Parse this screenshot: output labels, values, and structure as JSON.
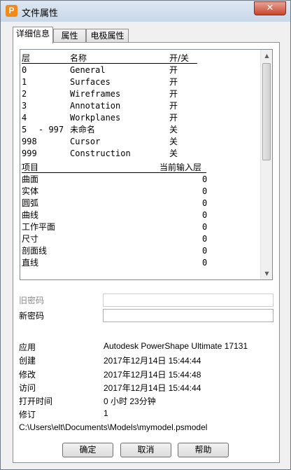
{
  "window": {
    "title": "文件属性",
    "app_icon_letter": "P",
    "close_glyph": "✕"
  },
  "tabs": [
    {
      "label": "详细信息",
      "active": true
    },
    {
      "label": "属性",
      "active": false
    },
    {
      "label": "电极属性",
      "active": false
    }
  ],
  "levels": {
    "headers": {
      "level": "层",
      "name": "名称",
      "onoff": "开/关"
    },
    "rows": [
      {
        "level": "0",
        "range_end": "",
        "name": "General",
        "state": "开"
      },
      {
        "level": "1",
        "range_end": "",
        "name": "Surfaces",
        "state": "开"
      },
      {
        "level": "2",
        "range_end": "",
        "name": "Wireframes",
        "state": "开"
      },
      {
        "level": "3",
        "range_end": "",
        "name": "Annotation",
        "state": "开"
      },
      {
        "level": "4",
        "range_end": "",
        "name": "Workplanes",
        "state": "开"
      },
      {
        "level": "5",
        "range_end": "- 997",
        "name": "未命名",
        "state": "关"
      },
      {
        "level": "998",
        "range_end": "",
        "name": "Cursor",
        "state": "关"
      },
      {
        "level": "999",
        "range_end": "",
        "name": "Construction",
        "state": "关"
      }
    ]
  },
  "input_levels": {
    "headers": {
      "item": "项目",
      "current": "当前输入层"
    },
    "rows": [
      {
        "item": "曲面",
        "value": "0"
      },
      {
        "item": "实体",
        "value": "0"
      },
      {
        "item": "圆弧",
        "value": "0"
      },
      {
        "item": "曲线",
        "value": "0"
      },
      {
        "item": "工作平面",
        "value": "0"
      },
      {
        "item": "尺寸",
        "value": "0"
      },
      {
        "item": "剖面线",
        "value": "0"
      },
      {
        "item": "直线",
        "value": "0"
      }
    ]
  },
  "scrollbar": {
    "up_glyph": "▲",
    "down_glyph": "▼"
  },
  "password": {
    "old_label": "旧密码",
    "old_value": "",
    "new_label": "新密码",
    "new_value": ""
  },
  "info": {
    "application_label": "应用",
    "application_value": "Autodesk PowerShape Ultimate 17131",
    "created_label": "创建",
    "created_value": "2017年12月14日 15:44:44",
    "modified_label": "修改",
    "modified_value": "2017年12月14日 15:44:48",
    "accessed_label": "访问",
    "accessed_value": "2017年12月14日 15:44:44",
    "open_time_label": "打开时间",
    "open_time_value": "0 小时 23分钟",
    "revision_label": "修订",
    "revision_value": "1",
    "file_path": "C:\\Users\\elt\\Documents\\Models\\mymodel.psmodel"
  },
  "buttons": {
    "ok": "确定",
    "cancel": "取消",
    "help": "帮助"
  }
}
